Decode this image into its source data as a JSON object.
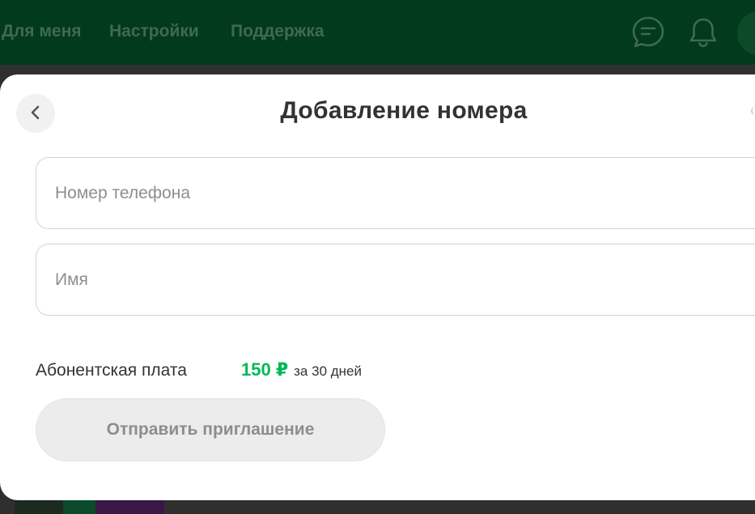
{
  "nav": {
    "items": [
      {
        "label": "Для меня"
      },
      {
        "label": "Настройки"
      },
      {
        "label": "Поддержка"
      }
    ]
  },
  "modal": {
    "title": "Добавление номера",
    "phone_placeholder": "Номер телефона",
    "name_placeholder": "Имя",
    "fee_label": "Абонентская плата",
    "fee_price": "150 ₽",
    "fee_period": "за 30 дней",
    "submit_label": "Отправить приглашение"
  },
  "colors": {
    "brand_green": "#00b956",
    "topbar": "#023a1e"
  },
  "icons": {
    "back": "chevron-left-icon",
    "chat": "chat-icon",
    "bell": "bell-icon"
  }
}
